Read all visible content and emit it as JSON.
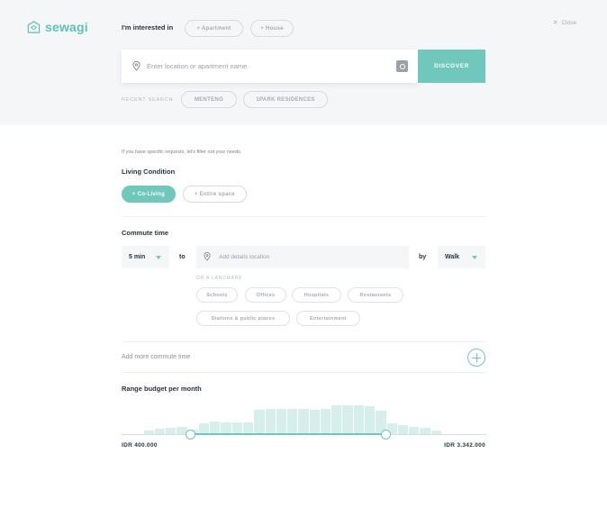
{
  "brand": {
    "name": "sewagi"
  },
  "header": {
    "interest_label": "I'm interested in",
    "interest_options": [
      "+ Apartment",
      "+ House"
    ],
    "close_label": "Close"
  },
  "search": {
    "placeholder": "Enter location or apartment name",
    "discover_label": "DISCOVER",
    "recent_label": "RECENT SEARCH",
    "recent_items": [
      "MENTENG",
      "1PARK RESIDENCES"
    ]
  },
  "filters": {
    "hint": "If you have specific requests, let's filter out your needs.",
    "living": {
      "title": "Living Condition",
      "options": [
        {
          "label": "+ Co-Living",
          "active": true
        },
        {
          "label": "+ Entire space",
          "active": false
        }
      ]
    },
    "commute": {
      "title": "Commute time",
      "duration": "5 min",
      "to_label": "to",
      "location_placeholder": "Add details location",
      "by_label": "by",
      "mode": "Walk",
      "landmark_label": "OR A LANDMARK",
      "landmarks": [
        "Schools",
        "Offices",
        "Hospitals",
        "Restaurants",
        "Stations & public places",
        "Entertainment"
      ],
      "add_more_label": "Add more commute time"
    },
    "budget": {
      "title": "Range budget per month",
      "min_label": "IDR 400.000",
      "max_label": "IDR 3.342.000",
      "range_start_fraction": 0.19,
      "range_end_fraction": 0.725,
      "histogram": [
        0,
        0,
        0.1,
        0.15,
        0.17,
        0.2,
        0.12,
        0.3,
        0.35,
        0.33,
        0.32,
        0.32,
        0.68,
        0.7,
        0.7,
        0.7,
        0.7,
        0.68,
        0.7,
        0.8,
        0.8,
        0.8,
        0.77,
        0.65,
        0.3,
        0.25,
        0.2,
        0.17,
        0.1,
        0,
        0,
        0,
        0
      ]
    }
  },
  "colors": {
    "accent": "#6fc8bb",
    "text": "#2a3340",
    "muted": "#a6acb4",
    "panel": "#f5f6f8"
  }
}
